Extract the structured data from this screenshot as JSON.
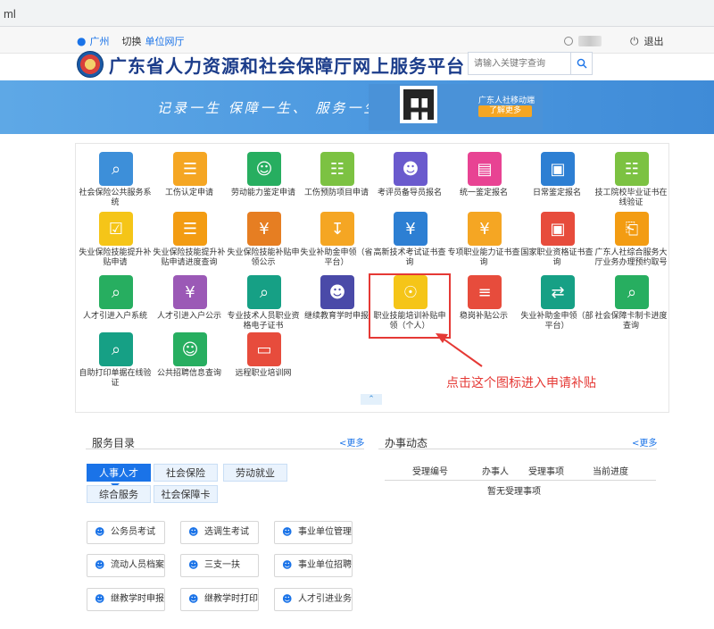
{
  "browser": {
    "url_fragment": "ml"
  },
  "topbar": {
    "location": "广州",
    "switch_label": "切换",
    "unit_label": "单位网厅",
    "logout_label": "退出"
  },
  "header": {
    "title": "广东省人力资源和社会保障厅网上服务平台",
    "search_placeholder": "请输入关键字查询"
  },
  "banner": {
    "slogan": "记录一生  保障一生、  服务一生",
    "app_title": "广东人社移动端",
    "app_button": "了解更多"
  },
  "services_grid": [
    {
      "label": "社会保险公共服务系统",
      "color": "#3d8fd9",
      "icon": "search-person-icon"
    },
    {
      "label": "工伤认定申请",
      "color": "#f5a623",
      "icon": "form-icon"
    },
    {
      "label": "劳动能力鉴定申请",
      "color": "#27ae60",
      "icon": "group-icon"
    },
    {
      "label": "工伤预防项目申请",
      "color": "#7cc242",
      "icon": "certificate-icon"
    },
    {
      "label": "考评员备导员报名",
      "color": "#6a5acd",
      "icon": "badge-icon"
    },
    {
      "label": "统一鉴定报名",
      "color": "#e84393",
      "icon": "card-icon"
    },
    {
      "label": "日常鉴定报名",
      "color": "#2d7fd3",
      "icon": "id-card-icon"
    },
    {
      "label": "技工院校毕业证书在线验证",
      "color": "#7cc242",
      "icon": "certificate-icon"
    },
    {
      "label": "失业保险技能提升补贴申请",
      "color": "#f5c518",
      "icon": "checklist-icon"
    },
    {
      "label": "失业保险技能提升补贴申请进度查询",
      "color": "#f39c12",
      "icon": "form-icon"
    },
    {
      "label": "失业保险技能补贴申领公示",
      "color": "#e67e22",
      "icon": "money-card-icon"
    },
    {
      "label": "失业补助金申领（省平台）",
      "color": "#f5a623",
      "icon": "download-icon"
    },
    {
      "label": "高新技术考试证书查询",
      "color": "#2d7fd3",
      "icon": "coin-hand-icon"
    },
    {
      "label": "专项职业能力证书查询",
      "color": "#f5a623",
      "icon": "yuan-icon"
    },
    {
      "label": "国家职业资格证书查询",
      "color": "#e74c3c",
      "icon": "id-card-icon"
    },
    {
      "label": "广东人社综合服务大厅业务办理预约取号",
      "color": "#f39c12",
      "icon": "document-icon"
    },
    {
      "label": "人才引进入户系统",
      "color": "#27ae60",
      "icon": "doc-search-icon"
    },
    {
      "label": "人才引进入户公示",
      "color": "#9b59b6",
      "icon": "money-doc-icon"
    },
    {
      "label": "专业技术人员职业资格电子证书",
      "color": "#16a085",
      "icon": "cert-search-icon"
    },
    {
      "label": "继续教育学时申报",
      "color": "#4a4aa8",
      "icon": "person-doc-icon"
    },
    {
      "label": "职业技能培训补贴申领（个人）",
      "color": "#f5c518",
      "icon": "subsidy-icon"
    },
    {
      "label": "稳岗补贴公示",
      "color": "#e74c3c",
      "icon": "stack-icon"
    },
    {
      "label": "失业补助金申领（部平台）",
      "color": "#16a085",
      "icon": "transfer-icon"
    },
    {
      "label": "社会保障卡制卡进度查询",
      "color": "#27ae60",
      "icon": "doc-search-icon"
    },
    {
      "label": "自助打印单据在线验证",
      "color": "#16a085",
      "icon": "print-search-icon"
    },
    {
      "label": "公共招聘信息查询",
      "color": "#27ae60",
      "icon": "recruit-icon"
    },
    {
      "label": "远程职业培训网",
      "color": "#e74c3c",
      "icon": "screen-icon"
    }
  ],
  "annotation": {
    "hint": "点击这个图标进入申请补贴"
  },
  "catalog": {
    "title": "服务目录",
    "more": "<更多",
    "tabs": [
      "人事人才",
      "社会保险",
      "劳动就业",
      "综合服务",
      "社会保障卡"
    ],
    "items": [
      "公务员考试",
      "选调生考试",
      "事业单位管理",
      "流动人员档案",
      "三支一扶",
      "事业单位招聘",
      "继教学时申报",
      "继教学时打印",
      "人才引进业务"
    ]
  },
  "affairs": {
    "title": "办事动态",
    "more": "<更多",
    "columns": [
      "受理编号",
      "办事人",
      "受理事项",
      "当前进度"
    ],
    "empty": "暂无受理事项"
  },
  "colors": {
    "accent": "#1a73e8",
    "highlight": "#e53935",
    "banner": "#4d99e0"
  }
}
